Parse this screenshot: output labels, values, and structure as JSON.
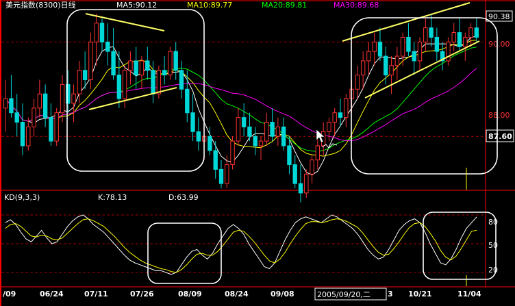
{
  "header": {
    "title": "美元指数(8300)日线",
    "ma5": "MA5:90.12",
    "ma10": "MA10:89.77",
    "ma20": "MA20:89.81",
    "ma30": "MA30:89.68"
  },
  "price_axis": {
    "labels": [
      "90.38",
      "90.00",
      "88.00",
      "87.60"
    ]
  },
  "kd_header": {
    "name": "KD(9,3,3)",
    "k": "K:78.13",
    "d": "D:63.99"
  },
  "kd_axis": {
    "labels": [
      "80",
      "50",
      "20"
    ]
  },
  "x_axis": {
    "labels": [
      "/09",
      "06/24",
      "07/11",
      "07/26",
      "08/09",
      "08/24",
      "09/08",
      "10/21",
      "11/04"
    ],
    "cursor_date": "2005/09/20,二",
    "partial": "3"
  },
  "colors": {
    "up": "#ff3232",
    "down": "#00d7d7",
    "ma5": "#ffffff",
    "ma10": "#ffff00",
    "ma20": "#00ff00",
    "ma30": "#ff00ff",
    "grid": "#a00000",
    "frame": "#ff0000"
  },
  "chart_data": [
    {
      "type": "candlestick",
      "title": "美元指数(8300)日线",
      "ylim": [
        86.9,
        90.6
      ],
      "gridlines": [
        90.0,
        88.0
      ],
      "candles": [
        [
          88.6,
          89.2,
          88.1,
          88.8
        ],
        [
          88.8,
          89.3,
          88.4,
          88.5
        ],
        [
          88.5,
          88.9,
          88.0,
          88.3
        ],
        [
          88.3,
          88.7,
          87.6,
          87.8
        ],
        [
          87.8,
          88.4,
          87.7,
          88.2
        ],
        [
          88.2,
          88.8,
          88.0,
          88.6
        ],
        [
          88.6,
          89.2,
          88.4,
          88.9
        ],
        [
          88.9,
          89.1,
          88.2,
          88.4
        ],
        [
          88.4,
          88.7,
          87.8,
          87.9
        ],
        [
          87.9,
          88.6,
          87.8,
          88.5
        ],
        [
          88.5,
          89.3,
          88.3,
          89.1
        ],
        [
          89.1,
          89.4,
          88.5,
          88.7
        ],
        [
          88.7,
          89.1,
          88.3,
          88.9
        ],
        [
          88.9,
          89.6,
          88.7,
          89.4
        ],
        [
          89.4,
          89.8,
          89.0,
          89.2
        ],
        [
          89.2,
          90.2,
          89.0,
          90.0
        ],
        [
          90.0,
          90.6,
          89.5,
          90.4
        ],
        [
          90.4,
          90.5,
          89.8,
          90.0
        ],
        [
          90.0,
          90.4,
          89.5,
          89.8
        ],
        [
          89.8,
          90.3,
          89.2,
          89.3
        ],
        [
          89.3,
          89.8,
          88.6,
          88.8
        ],
        [
          88.8,
          89.5,
          88.6,
          89.4
        ],
        [
          89.4,
          89.8,
          89.1,
          89.6
        ],
        [
          89.6,
          89.9,
          89.0,
          89.3
        ],
        [
          89.3,
          89.7,
          89.0,
          89.6
        ],
        [
          89.6,
          89.9,
          89.2,
          89.4
        ],
        [
          89.4,
          89.6,
          88.7,
          88.9
        ],
        [
          88.9,
          89.5,
          88.8,
          89.4
        ],
        [
          89.4,
          89.7,
          89.1,
          89.3
        ],
        [
          89.3,
          89.9,
          89.2,
          89.8
        ],
        [
          89.8,
          90.0,
          89.2,
          89.4
        ],
        [
          89.4,
          89.6,
          88.8,
          89.0
        ],
        [
          89.0,
          89.4,
          88.3,
          88.5
        ],
        [
          88.5,
          88.9,
          87.9,
          88.1
        ],
        [
          88.1,
          88.4,
          87.7,
          87.9
        ],
        [
          87.9,
          88.2,
          87.5,
          88.0
        ],
        [
          88.0,
          88.2,
          87.6,
          87.7
        ],
        [
          87.7,
          87.9,
          87.1,
          87.3
        ],
        [
          87.3,
          87.5,
          86.9,
          87.0
        ],
        [
          87.0,
          87.6,
          86.9,
          87.4
        ],
        [
          87.4,
          88.0,
          87.3,
          87.9
        ],
        [
          87.9,
          88.6,
          87.8,
          88.4
        ],
        [
          88.4,
          88.7,
          88.0,
          88.2
        ],
        [
          88.2,
          88.5,
          87.9,
          88.0
        ],
        [
          88.0,
          88.2,
          87.6,
          87.8
        ],
        [
          87.8,
          88.0,
          87.5,
          87.9
        ],
        [
          87.9,
          88.5,
          87.8,
          88.3
        ],
        [
          88.3,
          88.6,
          87.9,
          88.0
        ],
        [
          88.0,
          88.4,
          87.8,
          88.2
        ],
        [
          88.2,
          88.4,
          87.7,
          87.8
        ],
        [
          87.8,
          88.0,
          87.2,
          87.4
        ],
        [
          87.4,
          87.6,
          86.9,
          87.0
        ],
        [
          87.0,
          87.4,
          86.6,
          86.8
        ],
        [
          86.8,
          87.3,
          86.7,
          87.2
        ],
        [
          87.2,
          87.6,
          87.0,
          87.5
        ],
        [
          87.5,
          88.0,
          87.3,
          87.8
        ],
        [
          87.8,
          88.3,
          87.6,
          88.1
        ],
        [
          88.1,
          88.4,
          87.9,
          88.3
        ],
        [
          88.3,
          88.6,
          88.0,
          88.5
        ],
        [
          88.5,
          88.8,
          88.2,
          88.4
        ],
        [
          88.4,
          88.9,
          88.2,
          88.8
        ],
        [
          88.8,
          89.2,
          88.5,
          89.0
        ],
        [
          89.0,
          89.5,
          88.8,
          89.3
        ],
        [
          89.3,
          89.8,
          89.0,
          89.6
        ],
        [
          89.6,
          90.0,
          89.3,
          89.8
        ],
        [
          89.8,
          90.2,
          89.5,
          90.0
        ],
        [
          90.0,
          90.3,
          89.6,
          89.7
        ],
        [
          89.7,
          89.9,
          89.1,
          89.3
        ],
        [
          89.3,
          89.7,
          88.9,
          89.5
        ],
        [
          89.5,
          89.9,
          89.2,
          89.7
        ],
        [
          89.7,
          90.2,
          89.5,
          90.1
        ],
        [
          90.1,
          90.4,
          89.7,
          89.8
        ],
        [
          89.8,
          90.0,
          89.3,
          89.6
        ],
        [
          89.6,
          90.1,
          89.4,
          90.0
        ],
        [
          90.0,
          90.5,
          89.8,
          90.3
        ],
        [
          90.3,
          90.6,
          89.9,
          90.1
        ],
        [
          90.1,
          90.3,
          89.6,
          89.8
        ],
        [
          89.8,
          90.0,
          89.4,
          89.6
        ],
        [
          89.6,
          90.1,
          89.5,
          90.0
        ],
        [
          90.0,
          90.4,
          89.8,
          90.2
        ],
        [
          90.2,
          90.5,
          89.8,
          89.9
        ],
        [
          89.9,
          90.2,
          89.6,
          90.1
        ],
        [
          90.1,
          90.4,
          89.9,
          90.3
        ],
        [
          90.3,
          90.5,
          90.0,
          90.1
        ]
      ],
      "ma_series": [
        {
          "name": "MA5",
          "color": "#ffffff",
          "period": 5
        },
        {
          "name": "MA10",
          "color": "#ffff00",
          "period": 10
        },
        {
          "name": "MA20",
          "color": "#00ff00",
          "period": 20
        },
        {
          "name": "MA30",
          "color": "#ff00ff",
          "period": 30
        }
      ]
    },
    {
      "type": "line",
      "title": "KD(9,3,3)",
      "ylim": [
        10,
        90
      ],
      "gridlines": [
        80,
        50,
        20
      ],
      "series": [
        {
          "name": "K",
          "color": "#ffffff",
          "values": [
            72,
            75,
            70,
            62,
            55,
            52,
            58,
            64,
            56,
            50,
            52,
            60,
            68,
            74,
            78,
            80,
            76,
            70,
            66,
            62,
            56,
            50,
            44,
            38,
            33,
            30,
            28,
            26,
            24,
            22,
            22,
            20,
            18,
            20,
            28,
            36,
            42,
            44,
            38,
            34,
            40,
            50,
            58,
            66,
            70,
            66,
            60,
            50,
            42,
            34,
            26,
            24,
            30,
            42,
            54,
            64,
            72,
            76,
            78,
            76,
            74,
            72,
            76,
            80,
            78,
            74,
            70,
            66,
            60,
            52,
            44,
            38,
            34,
            36,
            44,
            54,
            64,
            70,
            74,
            76,
            72,
            62,
            50,
            40,
            30,
            28,
            34,
            44,
            56,
            66,
            72,
            78
          ]
        },
        {
          "name": "D",
          "color": "#ffff00",
          "values": [
            66,
            70,
            71,
            68,
            63,
            58,
            57,
            59,
            58,
            55,
            54,
            56,
            61,
            66,
            71,
            75,
            76,
            74,
            71,
            68,
            63,
            58,
            52,
            46,
            41,
            37,
            33,
            30,
            28,
            26,
            24,
            23,
            21,
            20,
            23,
            28,
            34,
            39,
            40,
            38,
            38,
            42,
            48,
            55,
            62,
            64,
            63,
            58,
            52,
            45,
            38,
            32,
            30,
            34,
            41,
            50,
            58,
            65,
            71,
            73,
            73,
            72,
            73,
            75,
            76,
            75,
            73,
            70,
            67,
            61,
            54,
            47,
            41,
            38,
            39,
            45,
            52,
            60,
            67,
            71,
            72,
            68,
            61,
            53,
            43,
            36,
            33,
            37,
            45,
            54,
            63,
            64
          ]
        }
      ]
    }
  ]
}
